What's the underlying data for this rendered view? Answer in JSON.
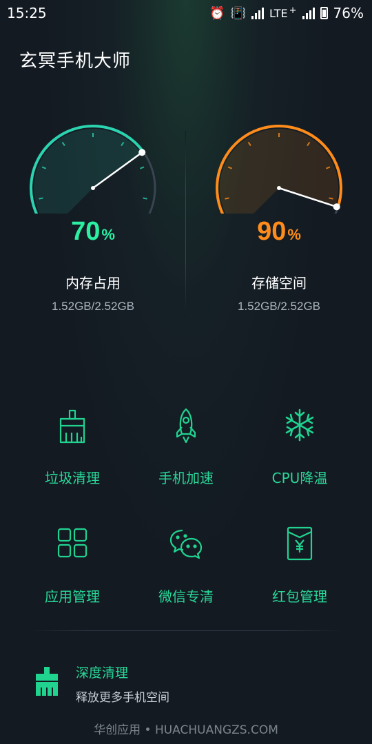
{
  "status_bar": {
    "time": "15:25",
    "network": "LTE",
    "battery": "76%"
  },
  "app": {
    "title": "玄冥手机大师"
  },
  "gauges": {
    "memory": {
      "percent": 70,
      "percent_text": "70",
      "unit": "%",
      "label": "内存占用",
      "detail": "1.52GB/2.52GB",
      "color": "#2bd4b0"
    },
    "storage": {
      "percent": 90,
      "percent_text": "90",
      "unit": "%",
      "label": "存储空间",
      "detail": "1.52GB/2.52GB",
      "color": "#ff8c1a"
    }
  },
  "tools": [
    {
      "label": "垃圾清理",
      "icon": "broom-icon"
    },
    {
      "label": "手机加速",
      "icon": "rocket-icon"
    },
    {
      "label": "CPU降温",
      "icon": "snowflake-icon"
    },
    {
      "label": "应用管理",
      "icon": "apps-grid-icon"
    },
    {
      "label": "微信专清",
      "icon": "wechat-icon"
    },
    {
      "label": "红包管理",
      "icon": "red-envelope-icon"
    }
  ],
  "deep_clean": {
    "title": "深度清理",
    "subtitle": "释放更多手机空间",
    "icon": "broom-icon"
  },
  "watermark": "华创应用 • HUACHUANGZS.COM",
  "colors": {
    "accent": "#28d898",
    "background": "#141a22"
  }
}
